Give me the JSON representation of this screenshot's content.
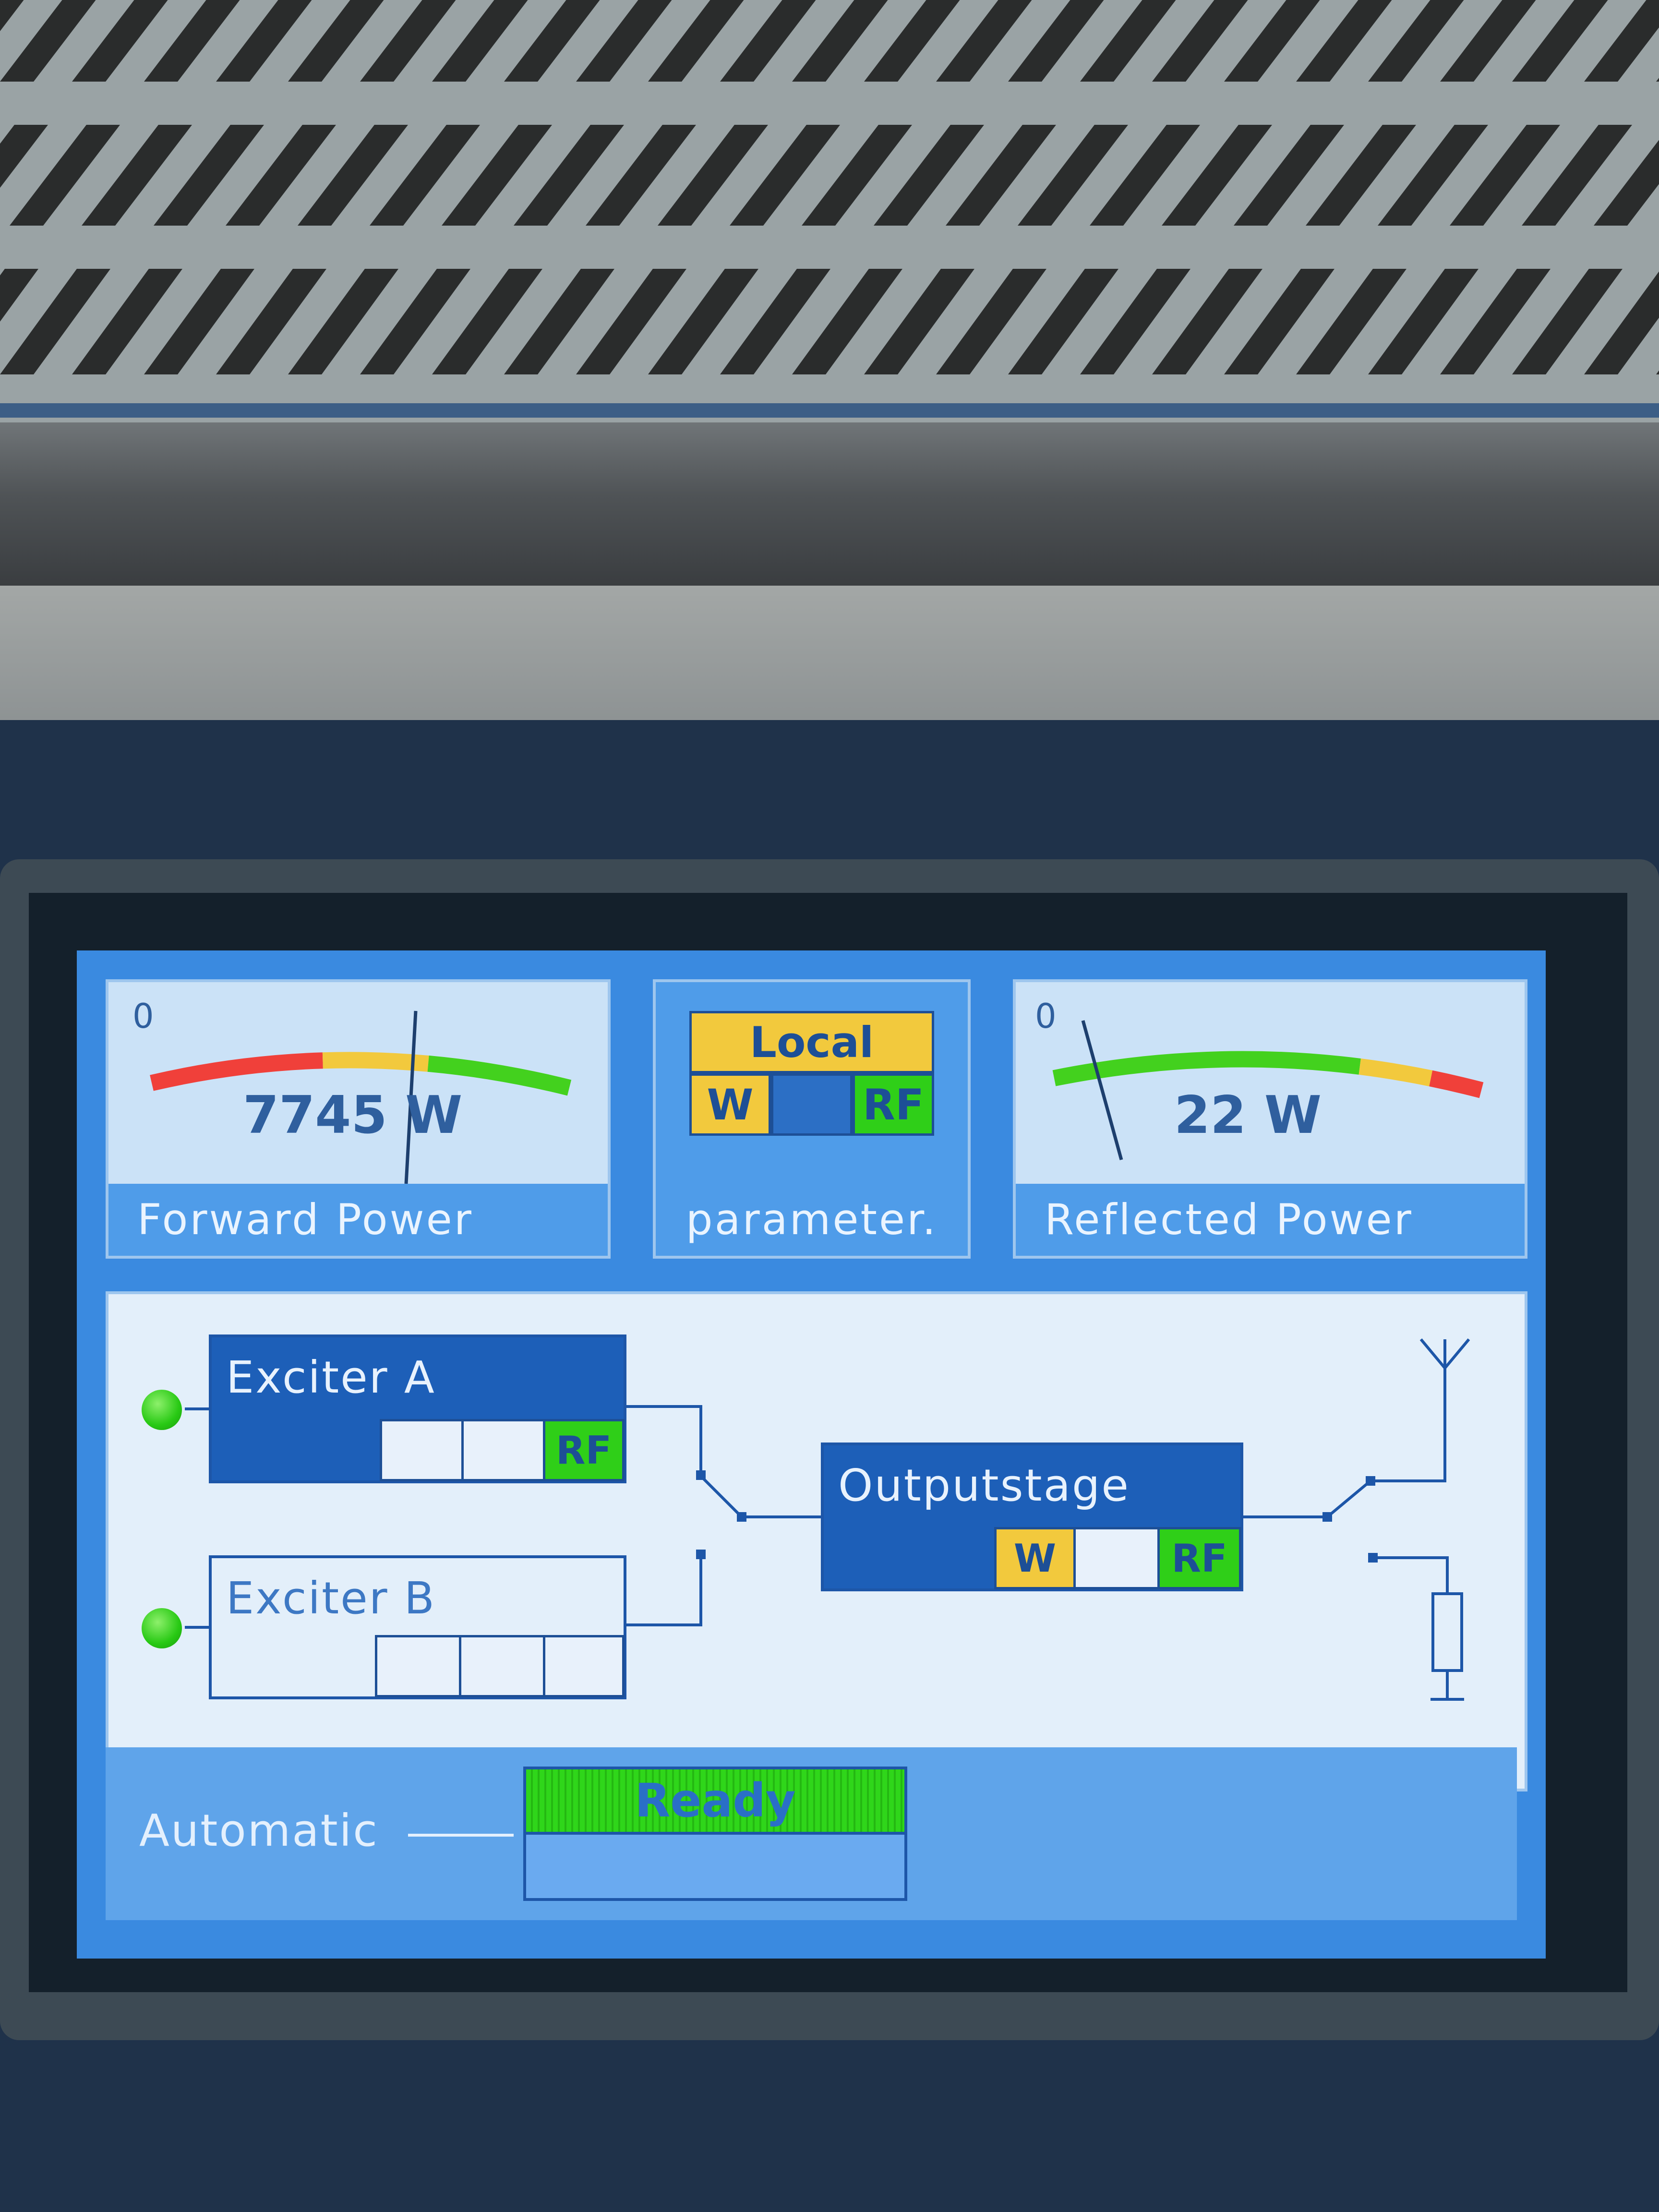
{
  "forward_meter": {
    "scale_min": "0",
    "value": "7745 W",
    "label": "Forward Power"
  },
  "mode_panel": {
    "mode": "Local",
    "indicator_w": "W",
    "indicator_rf": "RF",
    "label": "parameter."
  },
  "reflected_meter": {
    "scale_min": "0",
    "value": "22 W",
    "label": "Reflected Power"
  },
  "schematic": {
    "exciter_a": {
      "label": "Exciter A",
      "rf": "RF"
    },
    "exciter_b": {
      "label": "Exciter B"
    },
    "outputstage": {
      "label": "Outputstage",
      "w": "W",
      "rf": "RF"
    }
  },
  "footer": {
    "mode_label": "Automatic",
    "status": "Ready"
  },
  "colors": {
    "screen_blue": "#3a8ae0",
    "panel_light": "#cbe2f7",
    "block_blue": "#1d5fb8",
    "ok_green": "#2fcf18",
    "warn_yellow": "#f2c93d",
    "alarm_red": "#f0403a"
  }
}
